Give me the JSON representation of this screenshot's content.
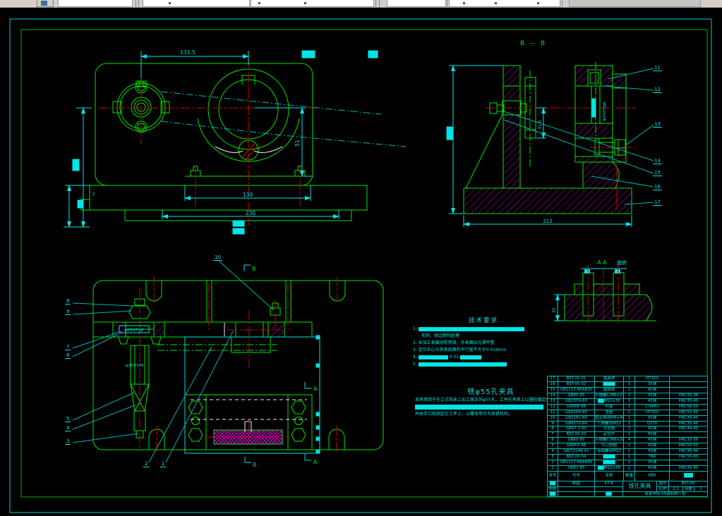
{
  "colors": {
    "line_green": "#00e400",
    "dim_cyan": "#00e5e5",
    "center_red": "#d40000",
    "hatch_magenta": "#c800c8",
    "canvas_bg": "#000000",
    "toolbar_bg": "#d4d0c8"
  },
  "labels": {
    "bb_section": "B — B",
    "aa_section": "A-A",
    "aa_rotate": "旋转",
    "b_top": "B",
    "b_bottom": "B",
    "a_top": "A",
    "a_bottom": "A"
  },
  "dims": {
    "front_width": "131.5",
    "d51": "51",
    "d130": "130",
    "d230": "230",
    "d2": "2",
    "d212": "212",
    "d315": "31.5",
    "bb_fit": "φ25H7/g6",
    "plan_fit_top": "φ25H7/g6",
    "plan_fit_bottom": "φ25H7/f6",
    "aa_width": "35"
  },
  "callouts": {
    "c1": "1",
    "c2": "2",
    "c3": "3",
    "c4": "4",
    "c5": "5",
    "c6": "6",
    "c7": "7",
    "c8": "8",
    "c9": "9",
    "c10": "10",
    "c11": "11",
    "c12": "12",
    "c13": "13",
    "c14": "14",
    "c15": "15",
    "c16": "16",
    "c17": "17"
  },
  "tech": {
    "title": "技术要求",
    "item1_no": "1.",
    "item1_sub": "毛刺、锐边倒钝处理",
    "item2": "2. 未加工表面涂防锈漆，外表面应光滑平整",
    "item3": "3. 定位中心与夹具底面的平行度不大于0.016mm",
    "item4_no": "4.",
    "item4_val": "0.01",
    "item5_no": "5."
  },
  "note": {
    "title": "铣φ55孔夹具",
    "line1": "本夹具用于在立式铣床上加工拨叉的φ55孔，工件在夹具上以圆柱面定位，",
    "line2": "并由手口轮固定在工件上，以螺母等作为夹紧机构。"
  },
  "bom": {
    "headers": {
      "num": "序号",
      "code": "代号",
      "name": "名称",
      "qty": "数量",
      "mat": "材料",
      "note": "███"
    },
    "rows": [
      {
        "num": "17",
        "code": "BST-00-01",
        "name": "夹具体",
        "qty": "1",
        "mat": "HT200",
        "note": ""
      },
      {
        "num": "16",
        "code": "BST-00-02",
        "name": "████",
        "qty": "1",
        "mat": "35钢",
        "note": ""
      },
      {
        "num": "15",
        "code": "GB1117-86AB30",
        "name": "圆锥销",
        "qty": "2",
        "mat": "45钢",
        "note": ""
      },
      {
        "num": "14",
        "code": "GB65-85",
        "name": "开槽螺钉M8×23",
        "qty": "2",
        "mat": "45钢",
        "note": "HRC33-38"
      },
      {
        "num": "13",
        "code": "GB2359-80",
        "name": "██M12×30",
        "qty": "1",
        "mat": "45钢",
        "note": "HRC35-40"
      },
      {
        "num": "12",
        "code": "GB888-88",
        "name": "衬套",
        "qty": "1",
        "mat": "CrWMn",
        "note": "HRC58-64"
      },
      {
        "num": "11",
        "code": "GB2268-80",
        "name": "垫圈",
        "qty": "1",
        "mat": "HT200",
        "note": "HRC55-60"
      },
      {
        "num": "10",
        "code": "GB2181-80",
        "name": "固定挡销M8×40",
        "qty": "1",
        "mat": "45钢",
        "note": "HRC35-40"
      },
      {
        "num": "9",
        "code": "GB6170-86",
        "name": "六角螺母M12",
        "qty": "2",
        "mat": "Q235",
        "note": "HRC35-40"
      },
      {
        "num": "8",
        "code": "GB97.2-85",
        "name": "平垫圈",
        "qty": "1",
        "mat": "45钢",
        "note": "HRC40-45"
      },
      {
        "num": "7",
        "code": "BST-00-03",
        "name": "定位件",
        "qty": "1",
        "mat": "45钢",
        "note": ""
      },
      {
        "num": "6",
        "code": "GB65-85",
        "name": "开槽螺钉M8×20",
        "qty": "4",
        "mat": "45钢",
        "note": "HRC33-38"
      },
      {
        "num": "5",
        "code": "GB851-88",
        "name": "手口垫圈",
        "qty": "1",
        "mat": "45钢",
        "note": "HRC50-55"
      },
      {
        "num": "4",
        "code": "GB/T2148-91",
        "name": "带肩螺母M12",
        "qty": "1",
        "mat": "45钢",
        "note": "HRC35-40"
      },
      {
        "num": "3",
        "code": "BST-00-04",
        "name": "████",
        "qty": "1",
        "mat": "T8A",
        "note": "HRC55-60"
      },
      {
        "num": "2",
        "code": "GB1117-86AB30",
        "name": "████",
        "qty": "2",
        "mat": "35钢",
        "note": ""
      },
      {
        "num": "1",
        "code": "GB67-85",
        "name": "██M12×49",
        "qty": "1",
        "mat": "45钢",
        "note": "HRC35-40"
      }
    ]
  },
  "titleblock": {
    "block_a1": "██",
    "drafter_label": "制图",
    "weight": "47.8",
    "title": "铣孔夹具",
    "drawing_no_label": "图号",
    "drawing_no": "BST-00",
    "checker_label": "校核",
    "scale_label": "比例",
    "scale": "1:1",
    "sheets_label": "张数",
    "sheets": "1",
    "block_a3": "██",
    "block_c3": "██",
    "org": "某某学院 05级机制一班"
  }
}
